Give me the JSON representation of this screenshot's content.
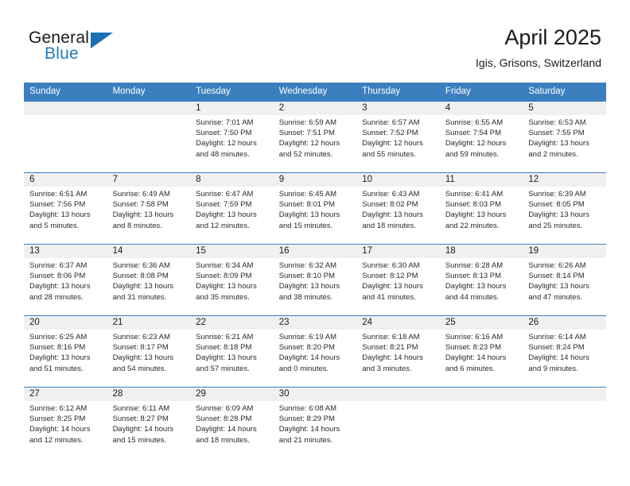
{
  "brand": {
    "name_part1": "General",
    "name_part2": "Blue",
    "logo_icon": "triangle-logo-icon",
    "accent_color": "#1b6fb5"
  },
  "header": {
    "title": "April 2025",
    "subtitle": "Igis, Grisons, Switzerland"
  },
  "calendar": {
    "header_bg": "#3b7fbf",
    "daynum_bg": "#f0f0f0",
    "weekday_headers": [
      "Sunday",
      "Monday",
      "Tuesday",
      "Wednesday",
      "Thursday",
      "Friday",
      "Saturday"
    ],
    "weeks": [
      [
        {
          "day": "",
          "lines": []
        },
        {
          "day": "",
          "lines": []
        },
        {
          "day": "1",
          "lines": [
            "Sunrise: 7:01 AM",
            "Sunset: 7:50 PM",
            "Daylight: 12 hours and 48 minutes."
          ]
        },
        {
          "day": "2",
          "lines": [
            "Sunrise: 6:59 AM",
            "Sunset: 7:51 PM",
            "Daylight: 12 hours and 52 minutes."
          ]
        },
        {
          "day": "3",
          "lines": [
            "Sunrise: 6:57 AM",
            "Sunset: 7:52 PM",
            "Daylight: 12 hours and 55 minutes."
          ]
        },
        {
          "day": "4",
          "lines": [
            "Sunrise: 6:55 AM",
            "Sunset: 7:54 PM",
            "Daylight: 12 hours and 59 minutes."
          ]
        },
        {
          "day": "5",
          "lines": [
            "Sunrise: 6:53 AM",
            "Sunset: 7:55 PM",
            "Daylight: 13 hours and 2 minutes."
          ]
        }
      ],
      [
        {
          "day": "6",
          "lines": [
            "Sunrise: 6:51 AM",
            "Sunset: 7:56 PM",
            "Daylight: 13 hours and 5 minutes."
          ]
        },
        {
          "day": "7",
          "lines": [
            "Sunrise: 6:49 AM",
            "Sunset: 7:58 PM",
            "Daylight: 13 hours and 8 minutes."
          ]
        },
        {
          "day": "8",
          "lines": [
            "Sunrise: 6:47 AM",
            "Sunset: 7:59 PM",
            "Daylight: 13 hours and 12 minutes."
          ]
        },
        {
          "day": "9",
          "lines": [
            "Sunrise: 6:45 AM",
            "Sunset: 8:01 PM",
            "Daylight: 13 hours and 15 minutes."
          ]
        },
        {
          "day": "10",
          "lines": [
            "Sunrise: 6:43 AM",
            "Sunset: 8:02 PM",
            "Daylight: 13 hours and 18 minutes."
          ]
        },
        {
          "day": "11",
          "lines": [
            "Sunrise: 6:41 AM",
            "Sunset: 8:03 PM",
            "Daylight: 13 hours and 22 minutes."
          ]
        },
        {
          "day": "12",
          "lines": [
            "Sunrise: 6:39 AM",
            "Sunset: 8:05 PM",
            "Daylight: 13 hours and 25 minutes."
          ]
        }
      ],
      [
        {
          "day": "13",
          "lines": [
            "Sunrise: 6:37 AM",
            "Sunset: 8:06 PM",
            "Daylight: 13 hours and 28 minutes."
          ]
        },
        {
          "day": "14",
          "lines": [
            "Sunrise: 6:36 AM",
            "Sunset: 8:08 PM",
            "Daylight: 13 hours and 31 minutes."
          ]
        },
        {
          "day": "15",
          "lines": [
            "Sunrise: 6:34 AM",
            "Sunset: 8:09 PM",
            "Daylight: 13 hours and 35 minutes."
          ]
        },
        {
          "day": "16",
          "lines": [
            "Sunrise: 6:32 AM",
            "Sunset: 8:10 PM",
            "Daylight: 13 hours and 38 minutes."
          ]
        },
        {
          "day": "17",
          "lines": [
            "Sunrise: 6:30 AM",
            "Sunset: 8:12 PM",
            "Daylight: 13 hours and 41 minutes."
          ]
        },
        {
          "day": "18",
          "lines": [
            "Sunrise: 6:28 AM",
            "Sunset: 8:13 PM",
            "Daylight: 13 hours and 44 minutes."
          ]
        },
        {
          "day": "19",
          "lines": [
            "Sunrise: 6:26 AM",
            "Sunset: 8:14 PM",
            "Daylight: 13 hours and 47 minutes."
          ]
        }
      ],
      [
        {
          "day": "20",
          "lines": [
            "Sunrise: 6:25 AM",
            "Sunset: 8:16 PM",
            "Daylight: 13 hours and 51 minutes."
          ]
        },
        {
          "day": "21",
          "lines": [
            "Sunrise: 6:23 AM",
            "Sunset: 8:17 PM",
            "Daylight: 13 hours and 54 minutes."
          ]
        },
        {
          "day": "22",
          "lines": [
            "Sunrise: 6:21 AM",
            "Sunset: 8:18 PM",
            "Daylight: 13 hours and 57 minutes."
          ]
        },
        {
          "day": "23",
          "lines": [
            "Sunrise: 6:19 AM",
            "Sunset: 8:20 PM",
            "Daylight: 14 hours and 0 minutes."
          ]
        },
        {
          "day": "24",
          "lines": [
            "Sunrise: 6:18 AM",
            "Sunset: 8:21 PM",
            "Daylight: 14 hours and 3 minutes."
          ]
        },
        {
          "day": "25",
          "lines": [
            "Sunrise: 6:16 AM",
            "Sunset: 8:23 PM",
            "Daylight: 14 hours and 6 minutes."
          ]
        },
        {
          "day": "26",
          "lines": [
            "Sunrise: 6:14 AM",
            "Sunset: 8:24 PM",
            "Daylight: 14 hours and 9 minutes."
          ]
        }
      ],
      [
        {
          "day": "27",
          "lines": [
            "Sunrise: 6:12 AM",
            "Sunset: 8:25 PM",
            "Daylight: 14 hours and 12 minutes."
          ]
        },
        {
          "day": "28",
          "lines": [
            "Sunrise: 6:11 AM",
            "Sunset: 8:27 PM",
            "Daylight: 14 hours and 15 minutes."
          ]
        },
        {
          "day": "29",
          "lines": [
            "Sunrise: 6:09 AM",
            "Sunset: 8:28 PM",
            "Daylight: 14 hours and 18 minutes."
          ]
        },
        {
          "day": "30",
          "lines": [
            "Sunrise: 6:08 AM",
            "Sunset: 8:29 PM",
            "Daylight: 14 hours and 21 minutes."
          ]
        },
        {
          "day": "",
          "lines": []
        },
        {
          "day": "",
          "lines": []
        },
        {
          "day": "",
          "lines": []
        }
      ]
    ]
  }
}
